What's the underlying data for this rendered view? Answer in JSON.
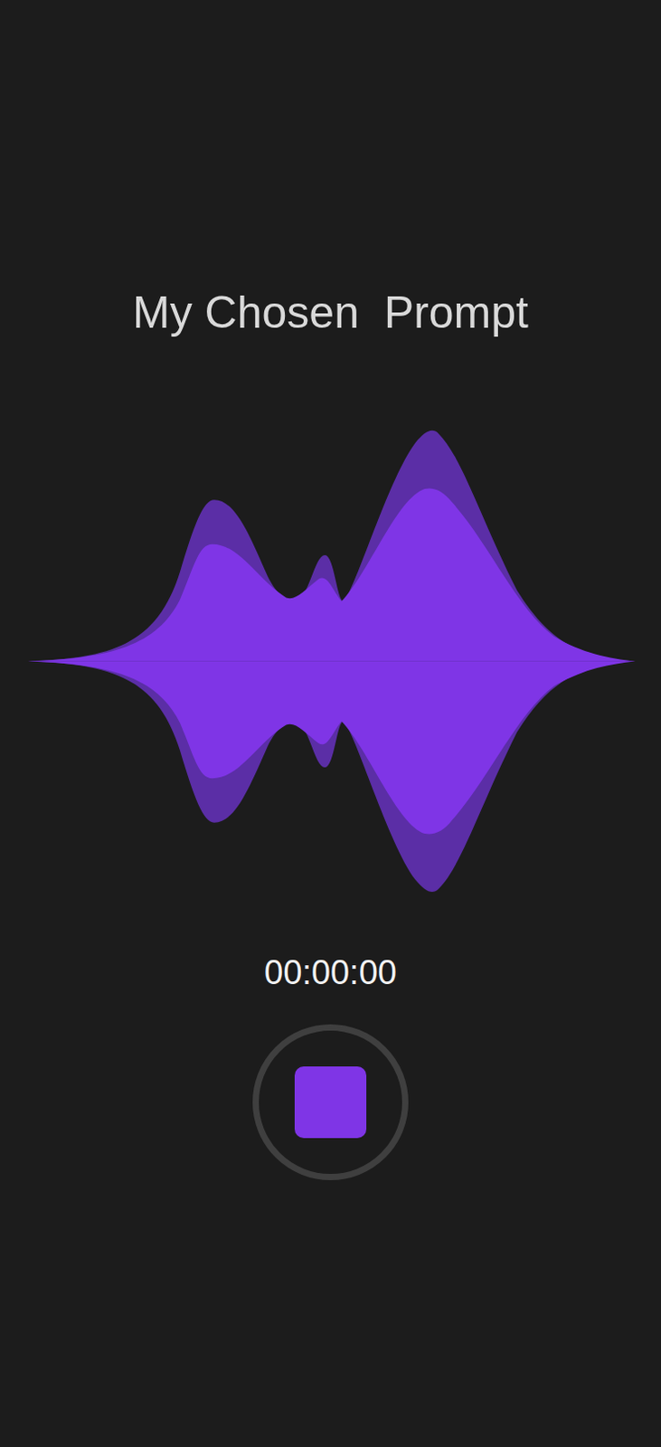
{
  "title": "My Chosen  Prompt",
  "timer": "00:00:00",
  "recorder": {
    "recording": true
  }
}
